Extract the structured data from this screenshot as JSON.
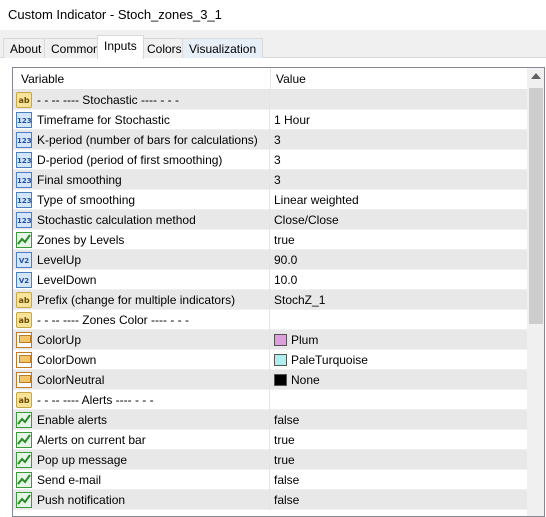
{
  "window": {
    "title": "Custom Indicator - Stoch_zones_3_1"
  },
  "tabs": [
    {
      "label": "About"
    },
    {
      "label": "Common"
    },
    {
      "label": "Inputs"
    },
    {
      "label": "Colors"
    },
    {
      "label": "Visualization"
    }
  ],
  "grid": {
    "col_variable": "Variable",
    "col_value": "Value",
    "rows": [
      {
        "icon": "ab",
        "variable": "-    -    -- ---- Stochastic ---- -    -    -",
        "value": ""
      },
      {
        "icon": "num",
        "variable": "Timeframe for Stochastic",
        "value": "1 Hour"
      },
      {
        "icon": "num",
        "variable": "K-period (number of bars for calculations)",
        "value": "3"
      },
      {
        "icon": "num",
        "variable": "D-period (period of first smoothing)",
        "value": "3"
      },
      {
        "icon": "num",
        "variable": "Final smoothing",
        "value": "3"
      },
      {
        "icon": "num",
        "variable": "Type of smoothing",
        "value": "Linear weighted"
      },
      {
        "icon": "num",
        "variable": "Stochastic calculation method",
        "value": "Close/Close"
      },
      {
        "icon": "bool",
        "variable": "Zones by Levels",
        "value": "true"
      },
      {
        "icon": "dbl",
        "variable": "LevelUp",
        "value": "90.0"
      },
      {
        "icon": "dbl",
        "variable": "LevelDown",
        "value": "10.0"
      },
      {
        "icon": "ab",
        "variable": "Prefix (change for multiple indicators)",
        "value": "StochZ_1"
      },
      {
        "icon": "ab",
        "variable": "-    -    -- ---- Zones Color ---- -    -    -",
        "value": ""
      },
      {
        "icon": "clr",
        "variable": "ColorUp",
        "value": "Plum",
        "swatch": "#dda0dd"
      },
      {
        "icon": "clr",
        "variable": "ColorDown",
        "value": "PaleTurquoise",
        "swatch": "#afeeee"
      },
      {
        "icon": "clr",
        "variable": "ColorNeutral",
        "value": "None",
        "swatch": "#000000"
      },
      {
        "icon": "ab",
        "variable": "-    -    -- ---- Alerts ---- -    -    -",
        "value": ""
      },
      {
        "icon": "bool",
        "variable": "Enable alerts",
        "value": "false"
      },
      {
        "icon": "bool",
        "variable": "Alerts on current bar",
        "value": "true"
      },
      {
        "icon": "bool",
        "variable": "Pop up message",
        "value": "true"
      },
      {
        "icon": "bool",
        "variable": "Send e-mail",
        "value": "false"
      },
      {
        "icon": "bool",
        "variable": "Push notification",
        "value": "false"
      }
    ]
  }
}
